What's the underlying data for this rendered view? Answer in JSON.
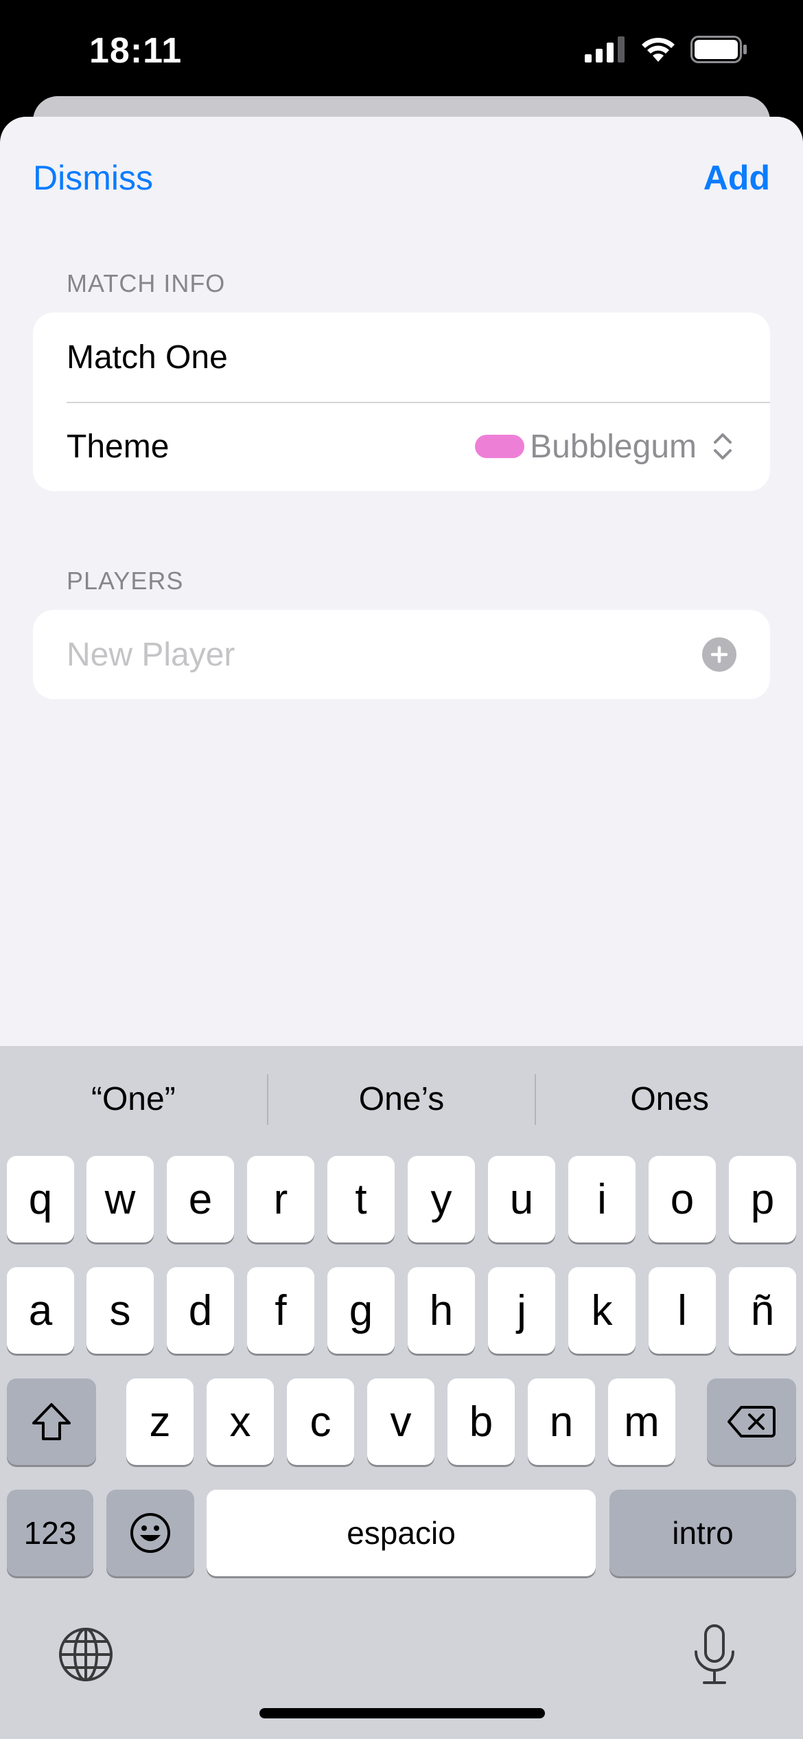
{
  "status_bar": {
    "time": "18:11",
    "icons": [
      "cellular-signal-icon",
      "wifi-icon",
      "battery-icon"
    ]
  },
  "nav": {
    "dismiss_label": "Dismiss",
    "add_label": "Add"
  },
  "match_info": {
    "header": "MATCH INFO",
    "name_value": "Match One",
    "theme_label": "Theme",
    "theme_value": "Bubblegum",
    "theme_color": "#ee7fd7"
  },
  "players": {
    "header": "PLAYERS",
    "placeholder": "New Player"
  },
  "keyboard": {
    "suggestions": [
      "“One”",
      "One’s",
      "Ones"
    ],
    "row1": [
      "q",
      "w",
      "e",
      "r",
      "t",
      "y",
      "u",
      "i",
      "o",
      "p"
    ],
    "row2": [
      "a",
      "s",
      "d",
      "f",
      "g",
      "h",
      "j",
      "k",
      "l",
      "ñ"
    ],
    "row3": [
      "z",
      "x",
      "c",
      "v",
      "b",
      "n",
      "m"
    ],
    "numbers_label": "123",
    "space_label": "espacio",
    "return_label": "intro"
  },
  "colors": {
    "accent": "#0a7cff",
    "sheet_bg": "#f2f2f7",
    "keyboard_bg": "#d1d3d9"
  }
}
